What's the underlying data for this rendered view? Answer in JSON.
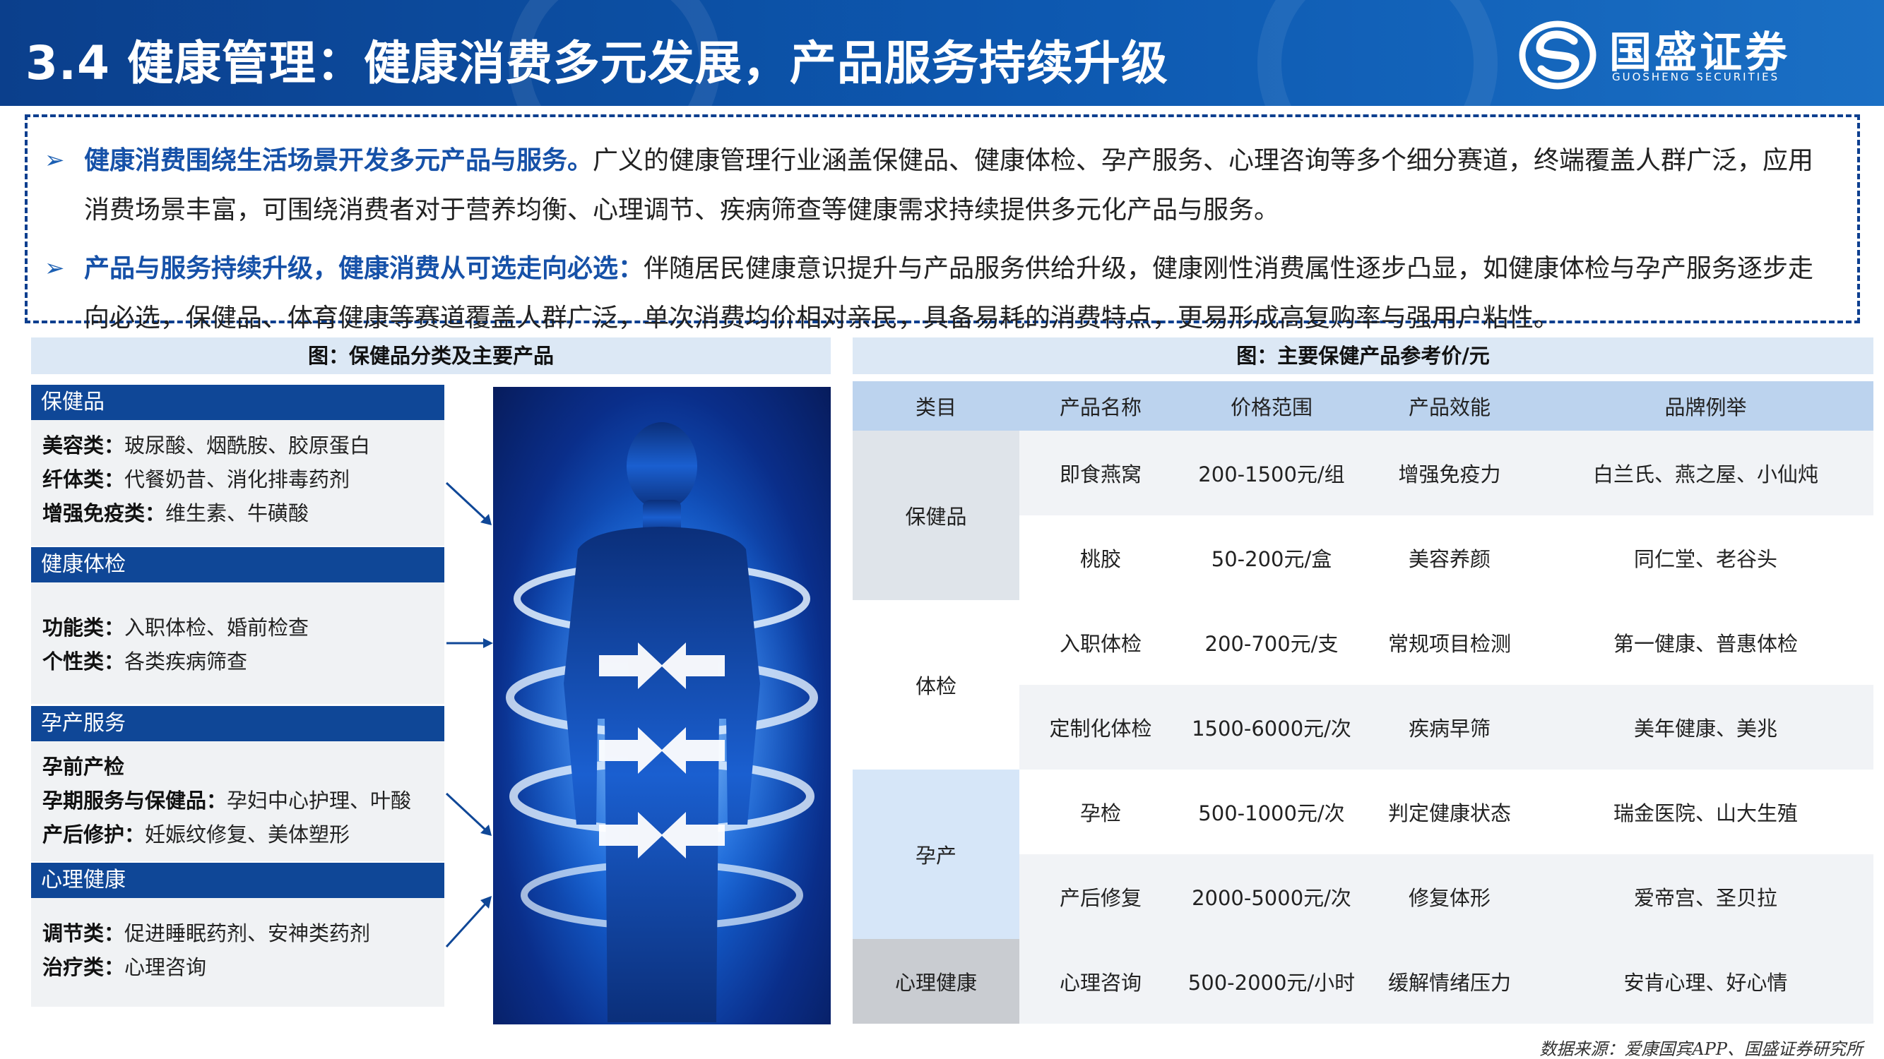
{
  "header": {
    "title": "3.4 健康管理：健康消费多元发展，产品服务持续升级",
    "logo_name": "国盛证券",
    "logo_sub": "GUOSHENG SECURITIES"
  },
  "intro": {
    "bullet1_lead": "健康消费围绕生活场景开发多元产品与服务。",
    "bullet1_text": "广义的健康管理行业涵盖保健品、健康体检、孕产服务、心理咨询等多个细分赛道，终端覆盖人群广泛，应用消费场景丰富，可围绕消费者对于营养均衡、心理调节、疾病筛查等健康需求持续提供多元化产品与服务。",
    "bullet2_lead": "产品与服务持续升级，健康消费从可选走向必选：",
    "bullet2_text": "伴随居民健康意识提升与产品服务供给升级，健康刚性消费属性逐步凸显，如健康体检与孕产服务逐步走向必选，保健品、体育健康等赛道覆盖人群广泛，单次消费均价相对亲民，具备易耗的消费特点，更易形成高复购率与强用户粘性。"
  },
  "left_panel": {
    "title": "图：保健品分类及主要产品",
    "categories": [
      {
        "head": "保健品",
        "lines": [
          {
            "label": "美容类：",
            "text": "玻尿酸、烟酰胺、胶原蛋白"
          },
          {
            "label": "纤体类：",
            "text": "代餐奶昔、消化排毒药剂"
          },
          {
            "label": "增强免疫类：",
            "text": "维生素、牛磺酸"
          }
        ]
      },
      {
        "head": "健康体检",
        "lines": [
          {
            "label": "功能类：",
            "text": "入职体检、婚前检查"
          },
          {
            "label": "个性类：",
            "text": "各类疾病筛查"
          }
        ]
      },
      {
        "head": "孕产服务",
        "lines": [
          {
            "label": "孕前产检",
            "text": ""
          },
          {
            "label": "孕期服务与保健品：",
            "text": "孕妇中心护理、叶酸"
          },
          {
            "label": "产后修护：",
            "text": "妊娠纹修复、美体塑形"
          }
        ]
      },
      {
        "head": "心理健康",
        "lines": [
          {
            "label": "调节类：",
            "text": "促进睡眠药剂、安神类药剂"
          },
          {
            "label": "治疗类：",
            "text": "心理咨询"
          }
        ]
      }
    ]
  },
  "right_panel": {
    "title": "图：主要保健产品参考价/元",
    "headers": [
      "类目",
      "产品名称",
      "价格范围",
      "产品效能",
      "品牌例举"
    ],
    "groups": [
      {
        "category": "保健品",
        "rows": [
          [
            "即食燕窝",
            "200-1500元/组",
            "增强免疫力",
            "白兰氏、燕之屋、小仙炖"
          ],
          [
            "桃胶",
            "50-200元/盒",
            "美容养颜",
            "同仁堂、老谷头"
          ]
        ]
      },
      {
        "category": "体检",
        "rows": [
          [
            "入职体检",
            "200-700元/支",
            "常规项目检测",
            "第一健康、普惠体检"
          ],
          [
            "定制化体检",
            "1500-6000元/次",
            "疾病早筛",
            "美年健康、美兆"
          ]
        ]
      },
      {
        "category": "孕产",
        "rows": [
          [
            "孕检",
            "500-1000元/次",
            "判定健康状态",
            "瑞金医院、山大生殖"
          ],
          [
            "产后修复",
            "2000-5000元/次",
            "修复体形",
            "爱帝宫、圣贝拉"
          ]
        ]
      },
      {
        "category": "心理健康",
        "rows": [
          [
            "心理咨询",
            "500-2000元/小时",
            "缓解情绪压力",
            "安肯心理、好心情"
          ]
        ]
      }
    ]
  },
  "source": "数据来源：爱康国宾APP、国盛证券研究所",
  "colors": {
    "brand_blue": "#0f4797",
    "bar_light": "#dce8f5",
    "table_header": "#bcd3ee"
  }
}
